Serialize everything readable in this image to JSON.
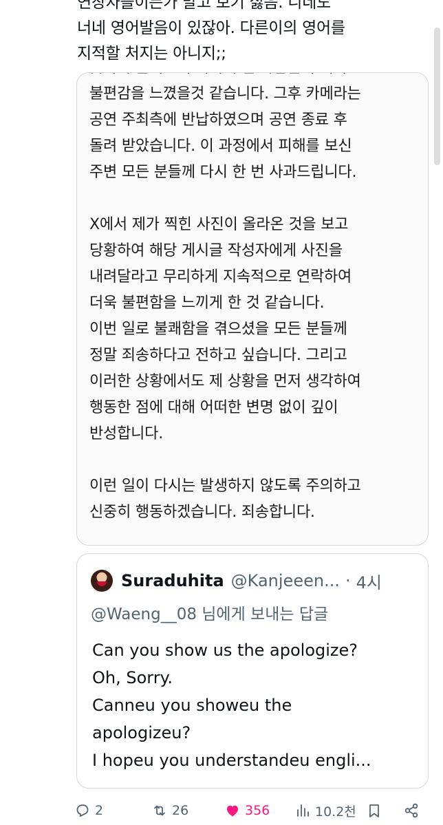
{
  "tweet": {
    "lines": [
      "연장자들이든가 말고 보기 싫음. 니네도",
      "너네 영어발음이 있잖아. 다른이의 영어를",
      "지적할 처지는 아니지;;"
    ]
  },
  "statement": {
    "lines": [
      "곳까지 들어오게 되어 주변 사람들이 더욱",
      "불편감을 느꼈을것 같습니다. 그후 카메라는",
      "공연 주최측에 반납하였으며 공연 종료 후",
      "돌려 받았습니다. 이 과정에서 피해를 보신",
      "주변 모든 분들께 다시 한 번 사과드립니다.",
      "",
      "X에서 제가 찍힌 사진이 올라온 것을 보고",
      "당황하여 해당 게시글 작성자에게 사진을",
      "내려달라고 무리하게 지속적으로 연락하여",
      "더욱 불편함을 느끼게 한 것 같습니다.",
      "이번 일로 불쾌함을 겪으셨을 모든 분들께",
      "정말 죄송하다고 전하고 싶습니다. 그리고",
      "이러한 상황에서도 제 상황을 먼저 생각하여",
      "행동한 점에 대해 어떠한 변명 없이 깊이",
      "반성합니다.",
      "",
      "이런 일이 다시는 발생하지 않도록 주의하고",
      "신중히 행동하겠습니다. 죄송합니다."
    ]
  },
  "quote": {
    "name": "Suraduhita",
    "handle": "@Kanjeeen...",
    "dot": "·",
    "time": "4시",
    "reply_to": "@Waeng__08 님에게 보내는 답글",
    "body": [
      "Can you show us the apologize?",
      "Oh, Sorry.",
      "Canneu you showeu the",
      "apologizeu?",
      "I hopeu you understandeu engli..."
    ]
  },
  "actions": {
    "replies": "2",
    "retweets": "26",
    "likes": "356",
    "views": "10.2천"
  },
  "colors": {
    "like": "#f91880",
    "muted": "#536471",
    "text": "#0f1419"
  }
}
